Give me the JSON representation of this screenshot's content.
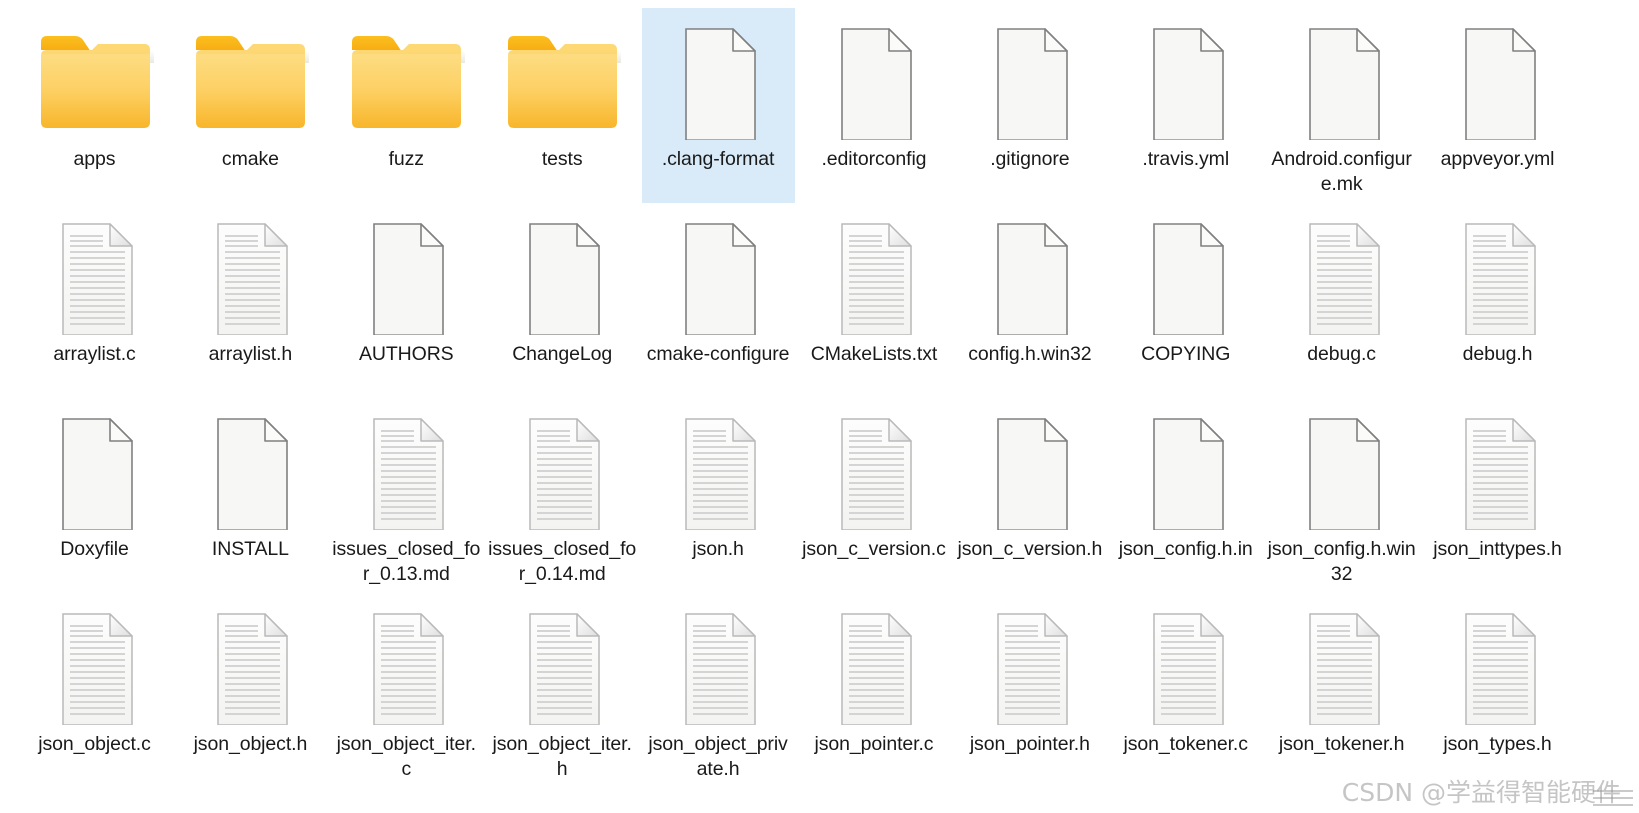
{
  "window": {
    "view_mode": "large-icons",
    "columns": 10,
    "rows": 4,
    "background_color": "#ffffff",
    "selection_color": "#d9eaf9",
    "folder_color": "#ffc627",
    "file_border_color": "#808080",
    "label_color": "#1a1a1a"
  },
  "watermark": {
    "text": "CSDN @学益得智能硬件"
  },
  "items": [
    {
      "name": "apps",
      "type": "folder",
      "selected": false
    },
    {
      "name": "cmake",
      "type": "folder",
      "selected": false
    },
    {
      "name": "fuzz",
      "type": "folder",
      "selected": false
    },
    {
      "name": "tests",
      "type": "folder",
      "selected": false
    },
    {
      "name": ".clang-format",
      "type": "file-blank",
      "selected": true
    },
    {
      "name": ".editorconfig",
      "type": "file-blank",
      "selected": false
    },
    {
      "name": ".gitignore",
      "type": "file-blank",
      "selected": false
    },
    {
      "name": ".travis.yml",
      "type": "file-blank",
      "selected": false
    },
    {
      "name": "Android.configure.mk",
      "type": "file-blank",
      "selected": false
    },
    {
      "name": "appveyor.yml",
      "type": "file-blank",
      "selected": false
    },
    {
      "name": "arraylist.c",
      "type": "file-text",
      "selected": false
    },
    {
      "name": "arraylist.h",
      "type": "file-text",
      "selected": false
    },
    {
      "name": "AUTHORS",
      "type": "file-blank",
      "selected": false
    },
    {
      "name": "ChangeLog",
      "type": "file-blank",
      "selected": false
    },
    {
      "name": "cmake-configure",
      "type": "file-blank",
      "selected": false
    },
    {
      "name": "CMakeLists.txt",
      "type": "file-text",
      "selected": false
    },
    {
      "name": "config.h.win32",
      "type": "file-blank",
      "selected": false
    },
    {
      "name": "COPYING",
      "type": "file-blank",
      "selected": false
    },
    {
      "name": "debug.c",
      "type": "file-text",
      "selected": false
    },
    {
      "name": "debug.h",
      "type": "file-text",
      "selected": false
    },
    {
      "name": "Doxyfile",
      "type": "file-blank",
      "selected": false
    },
    {
      "name": "INSTALL",
      "type": "file-blank",
      "selected": false
    },
    {
      "name": "issues_closed_for_0.13.md",
      "type": "file-text",
      "selected": false
    },
    {
      "name": "issues_closed_for_0.14.md",
      "type": "file-text",
      "selected": false
    },
    {
      "name": "json.h",
      "type": "file-text",
      "selected": false
    },
    {
      "name": "json_c_version.c",
      "type": "file-text",
      "selected": false
    },
    {
      "name": "json_c_version.h",
      "type": "file-blank",
      "selected": false
    },
    {
      "name": "json_config.h.in",
      "type": "file-blank",
      "selected": false
    },
    {
      "name": "json_config.h.win32",
      "type": "file-blank",
      "selected": false
    },
    {
      "name": "json_inttypes.h",
      "type": "file-text",
      "selected": false
    },
    {
      "name": "json_object.c",
      "type": "file-text",
      "selected": false
    },
    {
      "name": "json_object.h",
      "type": "file-text",
      "selected": false
    },
    {
      "name": "json_object_iter.c",
      "type": "file-text",
      "selected": false
    },
    {
      "name": "json_object_iter.h",
      "type": "file-text",
      "selected": false
    },
    {
      "name": "json_object_private.h",
      "type": "file-text",
      "selected": false
    },
    {
      "name": "json_pointer.c",
      "type": "file-text",
      "selected": false
    },
    {
      "name": "json_pointer.h",
      "type": "file-text",
      "selected": false
    },
    {
      "name": "json_tokener.c",
      "type": "file-text",
      "selected": false
    },
    {
      "name": "json_tokener.h",
      "type": "file-text",
      "selected": false
    },
    {
      "name": "json_types.h",
      "type": "file-text",
      "selected": false
    }
  ]
}
